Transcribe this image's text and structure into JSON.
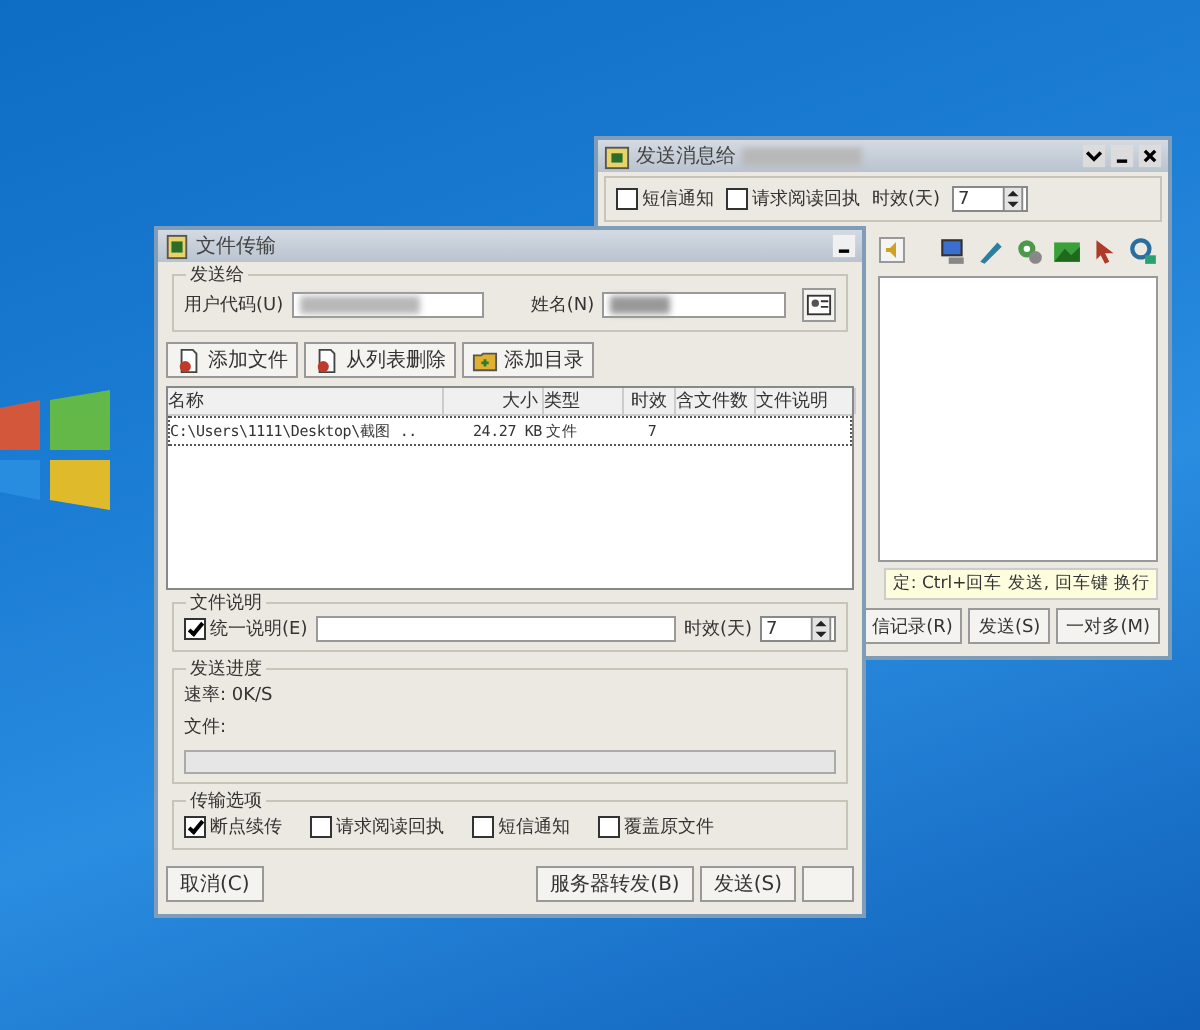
{
  "message_window": {
    "title": "发送消息给",
    "options": [
      {
        "label": "短信通知",
        "checked": false
      },
      {
        "label": "请求阅读回执",
        "checked": false
      }
    ],
    "expiry_label": "时效(天)",
    "expiry_value": "7",
    "hint": "定: Ctrl+回车 发送, 回车键 换行",
    "buttons": [
      "信记录(R)",
      "发送(S)",
      "一对多(M)"
    ]
  },
  "file_window": {
    "title": "文件传输",
    "recipient": {
      "group": "发送给",
      "user_code_label": "用户代码(U)",
      "name_label": "姓名(N)"
    },
    "toolbar": [
      "添加文件",
      "从列表删除",
      "添加目录"
    ],
    "table": {
      "columns": [
        "名称",
        "大小",
        "类型",
        "时效",
        "含文件数",
        "文件说明"
      ],
      "rows": [
        {
          "cells": [
            "C:\\Users\\1111\\Desktop\\截图 ..",
            "24.27 KB",
            "文件",
            "7",
            "",
            ""
          ],
          "selected": true
        }
      ]
    },
    "description": {
      "group": "文件说明",
      "unify_label": "统一说明(E)",
      "unify_checked": true,
      "expiry_label": "时效(天)",
      "expiry_value": "7"
    },
    "progress": {
      "group": "发送进度",
      "rate": "速率: 0K/S",
      "file": "文件:",
      "level": 0
    },
    "transfer": {
      "group": "传输选项",
      "options": [
        {
          "label": "断点续传",
          "checked": true
        },
        {
          "label": "请求阅读回执",
          "checked": false
        },
        {
          "label": "短信通知",
          "checked": false
        },
        {
          "label": "覆盖原文件",
          "checked": false
        }
      ]
    },
    "buttons": [
      "取消(C)",
      "服务器转发(B)",
      "发送(S)"
    ]
  }
}
